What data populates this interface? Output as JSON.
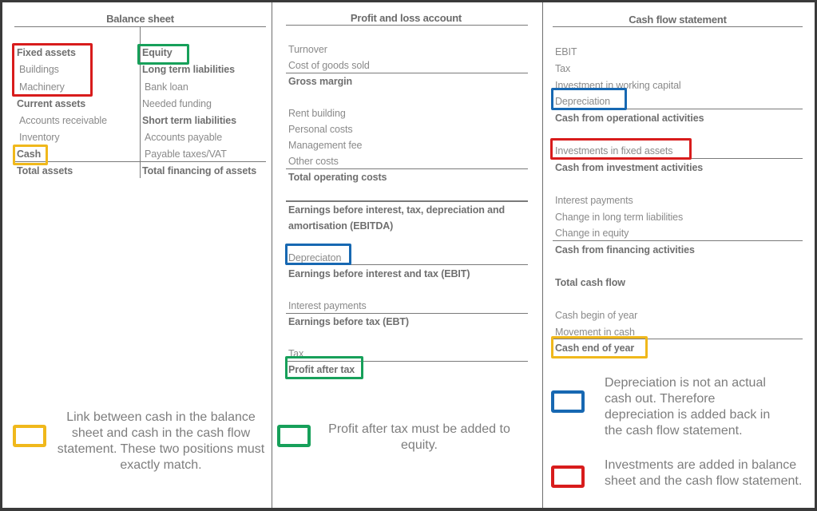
{
  "balance_sheet": {
    "title": "Balance sheet",
    "assets": {
      "fixed_assets": "Fixed assets",
      "buildings": "Buildings",
      "machinery": "Machinery",
      "current_assets": "Current assets",
      "accounts_receivable": "Accounts receivable",
      "inventory": "Inventory",
      "cash": "Cash",
      "total": "Total assets"
    },
    "financing": {
      "equity": "Equity",
      "long_term_liabilities": "Long term liabilities",
      "bank_loan": "Bank loan",
      "needed_funding": "Needed funding",
      "short_term_liabilities": "Short term liabilities",
      "accounts_payable": "Accounts payable",
      "payable_taxes": "Payable taxes/VAT",
      "total": "Total financing of assets"
    }
  },
  "profit_loss": {
    "title": "Profit and loss account",
    "turnover": "Turnover",
    "cogs": "Cost of goods sold",
    "gross_margin": "Gross margin",
    "rent": "Rent building",
    "personal_costs": "Personal costs",
    "management_fee": "Management fee",
    "other_costs": "Other costs",
    "total_operating_costs": "Total operating costs",
    "ebitda_line1": "Earnings before interest, tax, depreciation and",
    "ebitda_line2": "amortisation (EBITDA)",
    "depreciation": "Depreciaton",
    "ebit": "Earnings before interest and tax (EBIT)",
    "interest": "Interest payments",
    "ebt": "Earnings before tax (EBT)",
    "tax": "Tax",
    "profit_after_tax": "Profit after tax"
  },
  "cash_flow": {
    "title": "Cash flow statement",
    "ebit": "EBIT",
    "tax": "Tax",
    "working_capital": "Investment in working capital",
    "depreciation": "Depreciation",
    "operational": "Cash from operational activities",
    "investments_fixed": "Investments in fixed assets",
    "investment_activities": "Cash from investment activities",
    "interest": "Interest payments",
    "change_lt_liabilities": "Change in long term liabilities",
    "change_equity": "Change in equity",
    "financing": "Cash from financing activities",
    "total": "Total cash flow",
    "cash_begin": "Cash begin of year",
    "movement": "Movement in cash",
    "cash_end": "Cash end of year"
  },
  "legend": {
    "yellow": "Link between cash in the balance sheet and cash in the  cash flow statement. These two positions must exactly match.",
    "green": "Profit after tax must be added to equity.",
    "blue": "Depreciation is not an actual cash out. Therefore depreciation is added back in the cash flow statement.",
    "red": "Investments are added in balance sheet and  the cash flow statement."
  },
  "colors": {
    "red": "#d81c1c",
    "green": "#17a05a",
    "yellow": "#f0b81b",
    "blue": "#1768b2"
  }
}
